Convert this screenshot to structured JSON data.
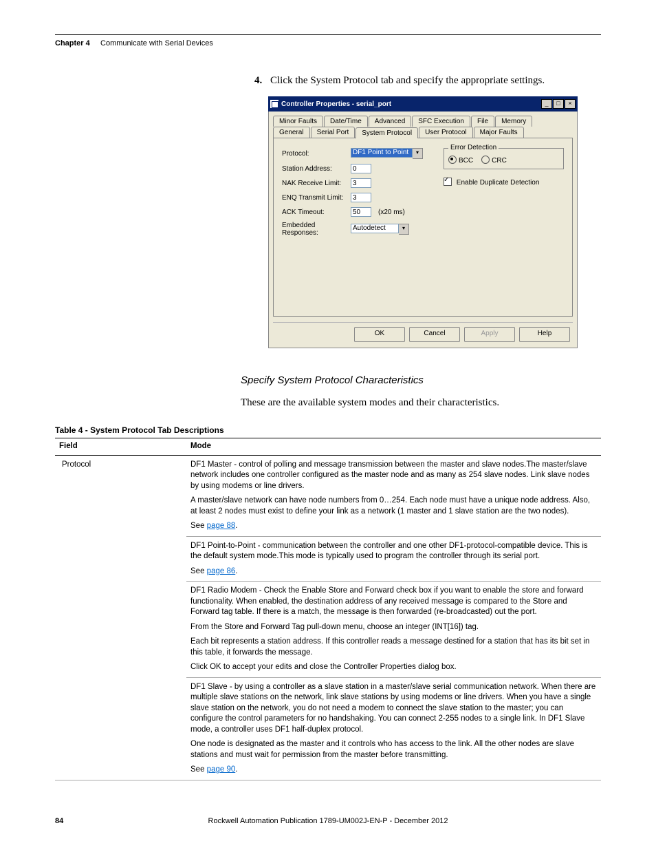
{
  "header": {
    "chapter_label": "Chapter 4",
    "chapter_title": "Communicate with Serial Devices"
  },
  "step": {
    "number": "4.",
    "text": "Click the System Protocol tab and specify the appropriate settings."
  },
  "dialog": {
    "title": "Controller Properties - serial_port",
    "win_min": "_",
    "win_max": "□",
    "win_close": "×",
    "tabs_row1": [
      "Minor Faults",
      "Date/Time",
      "Advanced",
      "SFC Execution",
      "File",
      "Memory"
    ],
    "tabs_row2": [
      "General",
      "Serial Port",
      "System Protocol",
      "User Protocol",
      "Major Faults"
    ],
    "active_tab": "System Protocol",
    "fields": {
      "protocol_label": "Protocol:",
      "protocol_value": "DF1 Point to Point",
      "station_label": "Station Address:",
      "station_value": "0",
      "nak_label": "NAK Receive Limit:",
      "nak_value": "3",
      "enq_label": "ENQ Transmit Limit:",
      "enq_value": "3",
      "ack_label": "ACK Timeout:",
      "ack_value": "50",
      "ack_unit": "(x20 ms)",
      "embedded_label": "Embedded Responses:",
      "embedded_value": "Autodetect"
    },
    "error_group": {
      "legend": "Error Detection",
      "bcc": "BCC",
      "crc": "CRC",
      "bcc_checked": true
    },
    "dup_detect": {
      "label": "Enable Duplicate Detection",
      "checked": true
    },
    "buttons": {
      "ok": "OK",
      "cancel": "Cancel",
      "apply": "Apply",
      "help": "Help"
    }
  },
  "sections": {
    "subhead": "Specify System Protocol Characteristics",
    "intro": "These are the available system modes and their characteristics."
  },
  "table": {
    "caption": "Table 4 - System Protocol Tab Descriptions",
    "head_field": "Field",
    "head_mode": "Mode",
    "rows": [
      {
        "field": "Protocol",
        "cells": [
          {
            "paras": [
              "DF1 Master - control of polling and message transmission between the master and slave nodes.The master/slave network includes one controller configured as the master node and as many as 254 slave nodes. Link slave nodes by using modems or line drivers.",
              "A master/slave network can have node numbers from 0…254. Each node must have a unique node address. Also, at least 2 nodes must exist to define your link as a network (1 master and 1 slave station are the two nodes)."
            ],
            "link_prefix": "See ",
            "link_text": "page 88",
            "link_suffix": "."
          },
          {
            "paras": [
              "DF1 Point-to-Point - communication between the controller and one other DF1-protocol-compatible device. This is the default system mode.This mode is typically used to program the controller through its serial port."
            ],
            "link_prefix": "See ",
            "link_text": "page 86",
            "link_suffix": "."
          },
          {
            "paras": [
              "DF1 Radio Modem -  Check the Enable Store and Forward check box if you want to enable the store and forward functionality. When enabled, the destination address of any received message is compared to the Store and Forward tag table. If there is a match, the message is then forwarded (re-broadcasted) out the port.",
              "From the Store and Forward Tag pull-down menu, choose an integer (INT[16]) tag.",
              "Each bit represents a station address. If this controller reads a message destined for a station that has its bit set in this table, it forwards the message.",
              "Click OK to accept your edits and close the Controller Properties dialog box."
            ]
          },
          {
            "paras": [
              "DF1 Slave - by using a controller as a slave station in a master/slave serial communication network. When there are multiple slave stations on the network, link slave stations by using modems or line drivers. When you have a single slave station on the network, you do not need a modem to connect the slave station to the master; you can configure the control parameters for no handshaking. You can connect 2-255 nodes to a single link. In DF1 Slave mode, a controller uses DF1 half-duplex protocol.",
              "One node is designated as the master and it controls who has access to the link. All the other nodes are slave stations and must wait for permission from the master before transmitting."
            ],
            "link_prefix": "See ",
            "link_text": "page 90",
            "link_suffix": "."
          }
        ]
      }
    ]
  },
  "footer": {
    "page": "84",
    "pub": "Rockwell Automation Publication 1789-UM002J-EN-P - December 2012"
  }
}
